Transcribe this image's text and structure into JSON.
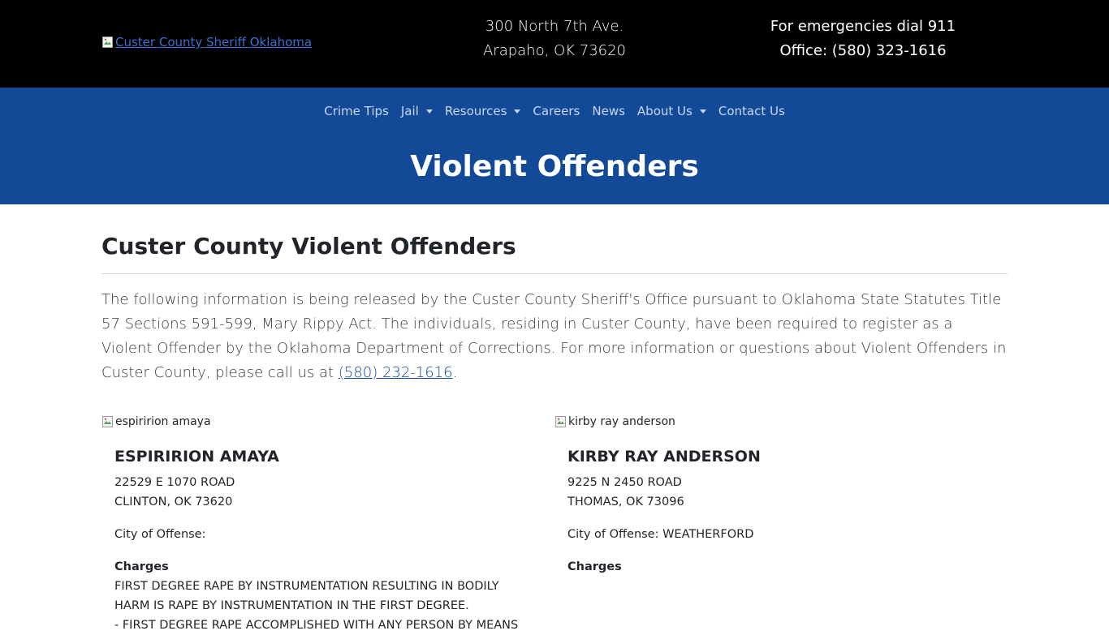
{
  "header": {
    "logo_alt": "Custer County Sheriff Oklahoma",
    "address_line1": "300 North 7th Ave.",
    "address_line2": "Arapaho, OK 73620",
    "emergency_line": "For emergencies dial 911",
    "office_line": "Office: (580) 323-1616"
  },
  "nav": {
    "items": [
      {
        "label": "Crime Tips",
        "dropdown": false
      },
      {
        "label": "Jail",
        "dropdown": true
      },
      {
        "label": "Resources",
        "dropdown": true
      },
      {
        "label": "Careers",
        "dropdown": false
      },
      {
        "label": "News",
        "dropdown": false
      },
      {
        "label": "About Us",
        "dropdown": true
      },
      {
        "label": "Contact Us",
        "dropdown": false
      }
    ]
  },
  "hero": {
    "title": "Violent Offenders"
  },
  "main": {
    "title": "Custer County Violent Offenders",
    "intro_text": "The following information is being released by the Custer County Sheriff's Office pursuant to Oklahoma State Statutes Title 57 Sections 591-599, Mary Rippy Act. The individuals, residing in Custer County, have been required to register as a Violent Offender by the Oklahoma Department of Corrections. For more information or questions about Violent Offenders in Custer County, please call us at ",
    "phone_link": "(580) 232-1616",
    "intro_end": "."
  },
  "offenders": [
    {
      "photo_alt": "espiririon amaya",
      "name": "ESPIRIRION AMAYA",
      "address_line1": "22529 E 1070 ROAD",
      "address_line2": "CLINTON, OK 73620",
      "city_of_offense": "City of Offense:",
      "charges_label": "Charges",
      "charges": [
        "FIRST DEGREE RAPE BY INSTRUMENTATION RESULTING IN BODILY HARM IS RAPE BY INSTRUMENTATION IN THE FIRST DEGREE.",
        "- FIRST DEGREE RAPE ACCOMPLISHED WITH ANY PERSON BY MEANS"
      ]
    },
    {
      "photo_alt": "kirby ray anderson",
      "name": "KIRBY RAY ANDERSON",
      "address_line1": "9225 N 2450 ROAD",
      "address_line2": "THOMAS, OK 73096",
      "city_of_offense": "City of Offense: WEATHERFORD",
      "charges_label": "Charges",
      "charges": []
    }
  ],
  "colors": {
    "topbar_bg": "#000000",
    "nav_bg": "#134a98",
    "link": "#134a98"
  }
}
